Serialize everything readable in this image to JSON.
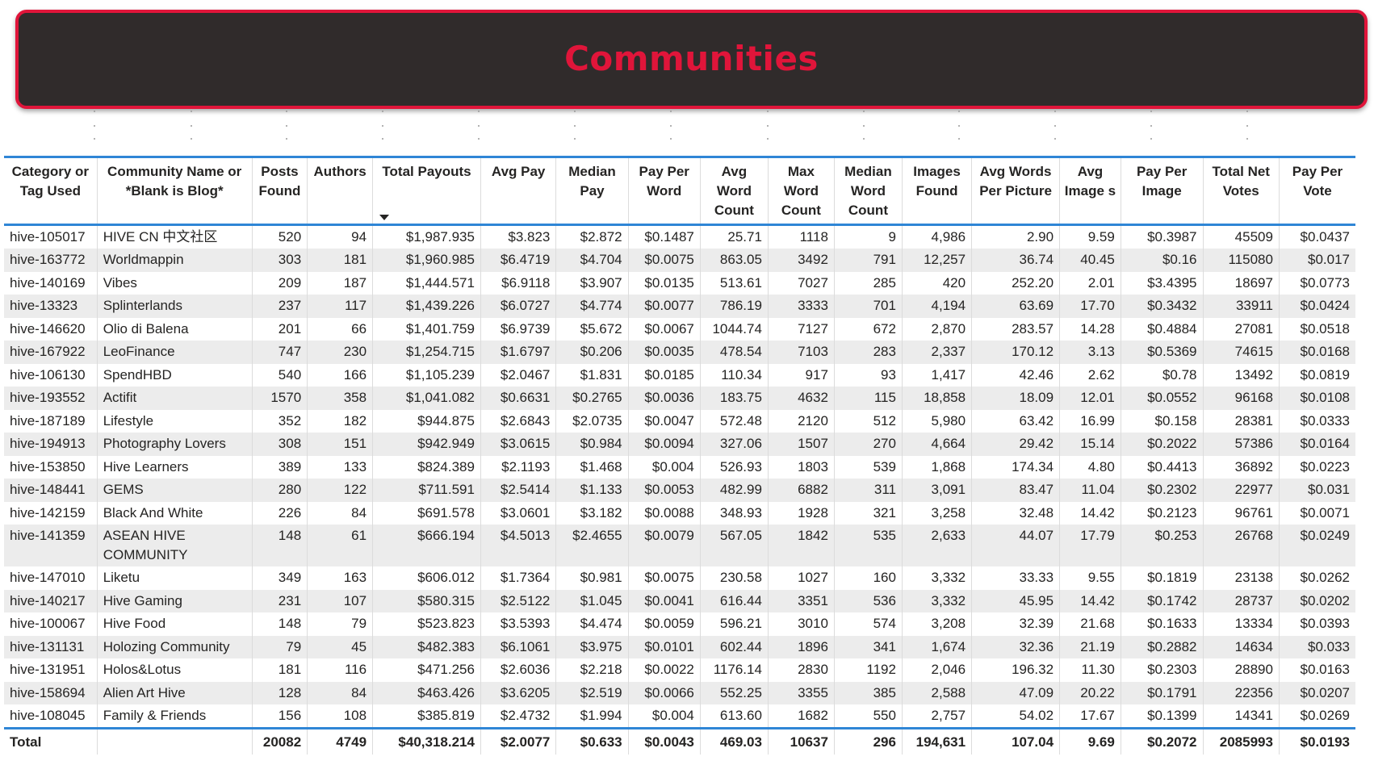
{
  "title": "Communities",
  "columns": [
    "Category or Tag Used",
    "Community Name or *Blank is Blog*",
    "Posts Found",
    "Authors",
    "Total Payouts",
    "Avg Pay",
    "Median Pay",
    "Pay Per Word",
    "Avg Word Count",
    "Max Word Count",
    "Median Word Count",
    "Images Found",
    "Avg Words Per Picture",
    "Avg Image s",
    "Pay Per Image",
    "Total Net Votes",
    "Pay Per Vote"
  ],
  "sort": {
    "column": "Total Payouts",
    "direction": "descending"
  },
  "rows": [
    [
      "hive-105017",
      "HIVE CN 中文社区",
      "520",
      "94",
      "$1,987.935",
      "$3.823",
      "$2.872",
      "$0.1487",
      "25.71",
      "1118",
      "9",
      "4,986",
      "2.90",
      "9.59",
      "$0.3987",
      "45509",
      "$0.0437"
    ],
    [
      "hive-163772",
      "Worldmappin",
      "303",
      "181",
      "$1,960.985",
      "$6.4719",
      "$4.704",
      "$0.0075",
      "863.05",
      "3492",
      "791",
      "12,257",
      "36.74",
      "40.45",
      "$0.16",
      "115080",
      "$0.017"
    ],
    [
      "hive-140169",
      "Vibes",
      "209",
      "187",
      "$1,444.571",
      "$6.9118",
      "$3.907",
      "$0.0135",
      "513.61",
      "7027",
      "285",
      "420",
      "252.20",
      "2.01",
      "$3.4395",
      "18697",
      "$0.0773"
    ],
    [
      "hive-13323",
      "Splinterlands",
      "237",
      "117",
      "$1,439.226",
      "$6.0727",
      "$4.774",
      "$0.0077",
      "786.19",
      "3333",
      "701",
      "4,194",
      "63.69",
      "17.70",
      "$0.3432",
      "33911",
      "$0.0424"
    ],
    [
      "hive-146620",
      "Olio di Balena",
      "201",
      "66",
      "$1,401.759",
      "$6.9739",
      "$5.672",
      "$0.0067",
      "1044.74",
      "7127",
      "672",
      "2,870",
      "283.57",
      "14.28",
      "$0.4884",
      "27081",
      "$0.0518"
    ],
    [
      "hive-167922",
      "LeoFinance",
      "747",
      "230",
      "$1,254.715",
      "$1.6797",
      "$0.206",
      "$0.0035",
      "478.54",
      "7103",
      "283",
      "2,337",
      "170.12",
      "3.13",
      "$0.5369",
      "74615",
      "$0.0168"
    ],
    [
      "hive-106130",
      "SpendHBD",
      "540",
      "166",
      "$1,105.239",
      "$2.0467",
      "$1.831",
      "$0.0185",
      "110.34",
      "917",
      "93",
      "1,417",
      "42.46",
      "2.62",
      "$0.78",
      "13492",
      "$0.0819"
    ],
    [
      "hive-193552",
      "Actifit",
      "1570",
      "358",
      "$1,041.082",
      "$0.6631",
      "$0.2765",
      "$0.0036",
      "183.75",
      "4632",
      "115",
      "18,858",
      "18.09",
      "12.01",
      "$0.0552",
      "96168",
      "$0.0108"
    ],
    [
      "hive-187189",
      "Lifestyle",
      "352",
      "182",
      "$944.875",
      "$2.6843",
      "$2.0735",
      "$0.0047",
      "572.48",
      "2120",
      "512",
      "5,980",
      "63.42",
      "16.99",
      "$0.158",
      "28381",
      "$0.0333"
    ],
    [
      "hive-194913",
      "Photography Lovers",
      "308",
      "151",
      "$942.949",
      "$3.0615",
      "$0.984",
      "$0.0094",
      "327.06",
      "1507",
      "270",
      "4,664",
      "29.42",
      "15.14",
      "$0.2022",
      "57386",
      "$0.0164"
    ],
    [
      "hive-153850",
      "Hive Learners",
      "389",
      "133",
      "$824.389",
      "$2.1193",
      "$1.468",
      "$0.004",
      "526.93",
      "1803",
      "539",
      "1,868",
      "174.34",
      "4.80",
      "$0.4413",
      "36892",
      "$0.0223"
    ],
    [
      "hive-148441",
      "GEMS",
      "280",
      "122",
      "$711.591",
      "$2.5414",
      "$1.133",
      "$0.0053",
      "482.99",
      "6882",
      "311",
      "3,091",
      "83.47",
      "11.04",
      "$0.2302",
      "22977",
      "$0.031"
    ],
    [
      "hive-142159",
      "Black And White",
      "226",
      "84",
      "$691.578",
      "$3.0601",
      "$3.182",
      "$0.0088",
      "348.93",
      "1928",
      "321",
      "3,258",
      "32.48",
      "14.42",
      "$0.2123",
      "96761",
      "$0.0071"
    ],
    [
      "hive-141359",
      "ASEAN HIVE COMMUNITY",
      "148",
      "61",
      "$666.194",
      "$4.5013",
      "$2.4655",
      "$0.0079",
      "567.05",
      "1842",
      "535",
      "2,633",
      "44.07",
      "17.79",
      "$0.253",
      "26768",
      "$0.0249"
    ],
    [
      "hive-147010",
      "Liketu",
      "349",
      "163",
      "$606.012",
      "$1.7364",
      "$0.981",
      "$0.0075",
      "230.58",
      "1027",
      "160",
      "3,332",
      "33.33",
      "9.55",
      "$0.1819",
      "23138",
      "$0.0262"
    ],
    [
      "hive-140217",
      "Hive Gaming",
      "231",
      "107",
      "$580.315",
      "$2.5122",
      "$1.045",
      "$0.0041",
      "616.44",
      "3351",
      "536",
      "3,332",
      "45.95",
      "14.42",
      "$0.1742",
      "28737",
      "$0.0202"
    ],
    [
      "hive-100067",
      "Hive Food",
      "148",
      "79",
      "$523.823",
      "$3.5393",
      "$4.474",
      "$0.0059",
      "596.21",
      "3010",
      "574",
      "3,208",
      "32.39",
      "21.68",
      "$0.1633",
      "13334",
      "$0.0393"
    ],
    [
      "hive-131131",
      "Holozing Community",
      "79",
      "45",
      "$482.383",
      "$6.1061",
      "$3.975",
      "$0.0101",
      "602.44",
      "1896",
      "341",
      "1,674",
      "32.36",
      "21.19",
      "$0.2882",
      "14634",
      "$0.033"
    ],
    [
      "hive-131951",
      "Holos&Lotus",
      "181",
      "116",
      "$471.256",
      "$2.6036",
      "$2.218",
      "$0.0022",
      "1176.14",
      "2830",
      "1192",
      "2,046",
      "196.32",
      "11.30",
      "$0.2303",
      "28890",
      "$0.0163"
    ],
    [
      "hive-158694",
      "Alien Art Hive",
      "128",
      "84",
      "$463.426",
      "$3.6205",
      "$2.519",
      "$0.0066",
      "552.25",
      "3355",
      "385",
      "2,588",
      "47.09",
      "20.22",
      "$0.1791",
      "22356",
      "$0.0207"
    ],
    [
      "hive-108045",
      "Family & Friends",
      "156",
      "108",
      "$385.819",
      "$2.4732",
      "$1.994",
      "$0.004",
      "613.60",
      "1682",
      "550",
      "2,757",
      "54.02",
      "17.67",
      "$0.1399",
      "14341",
      "$0.0269"
    ]
  ],
  "total": [
    "Total",
    "",
    "20082",
    "4749",
    "$40,318.214",
    "$2.0077",
    "$0.633",
    "$0.0043",
    "469.03",
    "10637",
    "296",
    "194,631",
    "107.04",
    "9.69",
    "$0.2072",
    "2085993",
    "$0.0193"
  ],
  "colors": {
    "banner_bg": "#302b2b",
    "accent_red": "#e0153a",
    "header_rule": "#2f86d6",
    "stripe": "#ececec"
  }
}
